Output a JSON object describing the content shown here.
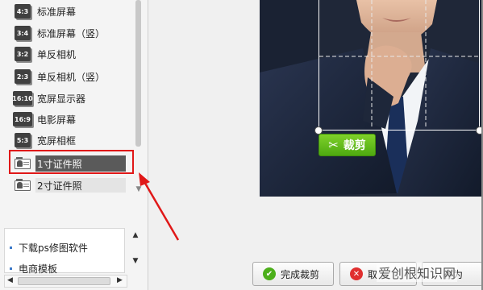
{
  "ratios": [
    {
      "icon": "4:3",
      "label": "标准屏幕"
    },
    {
      "icon": "3:4",
      "label": "标准屏幕（竖）"
    },
    {
      "icon": "3:2",
      "label": "单反相机"
    },
    {
      "icon": "2:3",
      "label": "单反相机（竖）"
    },
    {
      "icon": "16:10",
      "label": "宽屏显示器"
    },
    {
      "icon": "16:9",
      "label": "电影屏幕"
    },
    {
      "icon": "5:3",
      "label": "宽屏相框"
    }
  ],
  "id_items": [
    {
      "label": "1寸证件照",
      "selected": true
    },
    {
      "label": "2寸证件照",
      "selected": false
    }
  ],
  "links": [
    {
      "label": "下载ps修图软件"
    },
    {
      "label": "电商模板"
    }
  ],
  "crop_button_label": "裁剪",
  "buttons": {
    "finish": "完成裁剪",
    "cancel": "取",
    "save_as": "存为"
  },
  "watermark": "爱创根知识网",
  "colors": {
    "highlight": "#e01818",
    "crop_green": "#5cb818",
    "selected_bg": "#5a5a5a"
  }
}
